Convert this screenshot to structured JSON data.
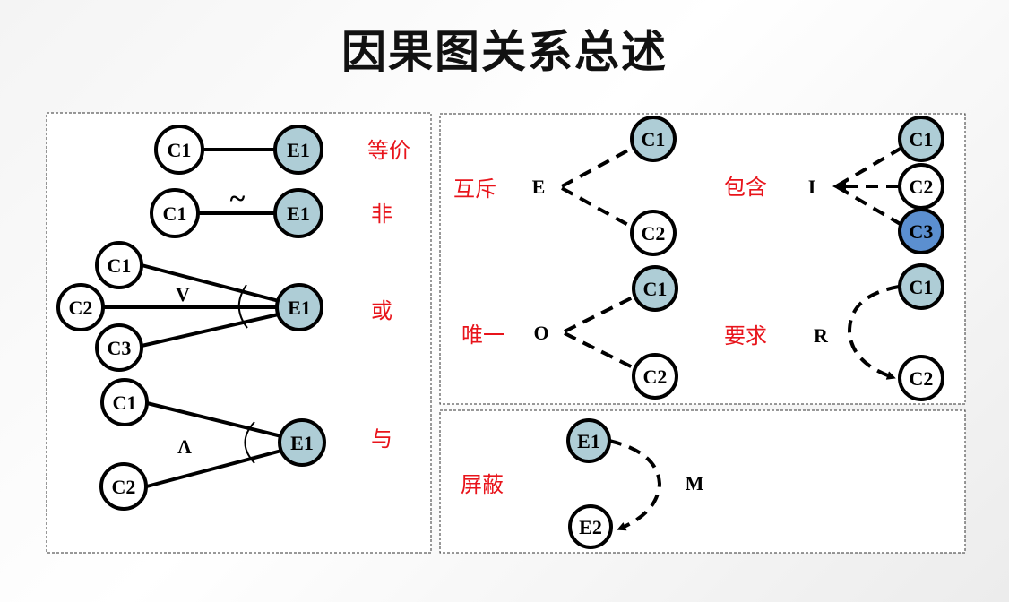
{
  "title": "因果图关系总述",
  "colors": {
    "cause_fill": "#ffffff",
    "effect_fill": "#aecdd6",
    "highlight_fill": "#5b8fd0",
    "relation_text": "#e8141b",
    "stroke": "#000000"
  },
  "relations": {
    "equivalence": {
      "label": "等价",
      "cause": "C1",
      "effect": "E1"
    },
    "not": {
      "label": "非",
      "cause": "C1",
      "effect": "E1",
      "symbol": "~"
    },
    "or": {
      "label": "或",
      "causes": [
        "C1",
        "C2",
        "C3"
      ],
      "effect": "E1",
      "symbol": "V"
    },
    "and": {
      "label": "与",
      "causes": [
        "C1",
        "C2"
      ],
      "effect": "E1",
      "symbol": "Λ"
    },
    "exclusive": {
      "label": "互斥",
      "op": "E",
      "nodes": [
        "C1",
        "C2"
      ]
    },
    "inclusive": {
      "label": "包含",
      "op": "I",
      "nodes": [
        "C1",
        "C2",
        "C3"
      ]
    },
    "one_only": {
      "label": "唯一",
      "op": "O",
      "nodes": [
        "C1",
        "C2"
      ]
    },
    "requires": {
      "label": "要求",
      "op": "R",
      "nodes": [
        "C1",
        "C2"
      ]
    },
    "masks": {
      "label": "屏蔽",
      "op": "M",
      "nodes": [
        "E1",
        "E2"
      ]
    }
  }
}
